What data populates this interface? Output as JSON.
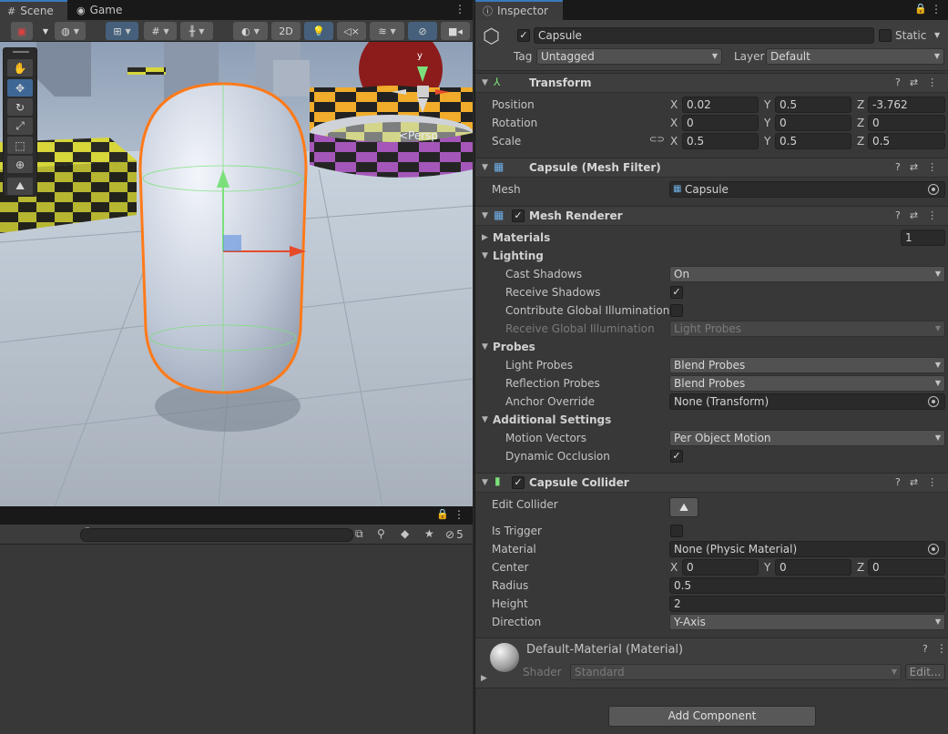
{
  "left_panel": {
    "tabs": [
      {
        "label": "Scene",
        "icon": "grid-icon"
      },
      {
        "label": "Game",
        "icon": "gamepad-icon"
      }
    ],
    "toolbar": {
      "mode_2d": "2D"
    },
    "viewport": {
      "persp_label": "<Persp",
      "gizmo_y_label": "y"
    },
    "lower_panel": {
      "search_placeholder": "",
      "visible_count": "5"
    }
  },
  "inspector": {
    "tab_label": "Inspector",
    "object": {
      "active": true,
      "name": "Capsule",
      "static_label": "Static",
      "tag_label": "Tag",
      "tag_value": "Untagged",
      "layer_label": "Layer",
      "layer_value": "Default"
    },
    "transform": {
      "title": "Transform",
      "position_label": "Position",
      "rotation_label": "Rotation",
      "scale_label": "Scale",
      "x": "X",
      "y": "Y",
      "z": "Z",
      "position": {
        "x": "0.02",
        "y": "0.5",
        "z": "-3.762"
      },
      "rotation": {
        "x": "0",
        "y": "0",
        "z": "0"
      },
      "scale": {
        "x": "0.5",
        "y": "0.5",
        "z": "0.5"
      }
    },
    "mesh_filter": {
      "title": "Capsule (Mesh Filter)",
      "mesh_label": "Mesh",
      "mesh_value": "Capsule"
    },
    "mesh_renderer": {
      "title": "Mesh Renderer",
      "materials_label": "Materials",
      "materials_count": "1",
      "lighting_label": "Lighting",
      "cast_shadows_label": "Cast Shadows",
      "cast_shadows_value": "On",
      "receive_shadows_label": "Receive Shadows",
      "contribute_gi_label": "Contribute Global Illumination",
      "receive_gi_label": "Receive Global Illumination",
      "receive_gi_value": "Light Probes",
      "probes_label": "Probes",
      "light_probes_label": "Light Probes",
      "light_probes_value": "Blend Probes",
      "reflection_probes_label": "Reflection Probes",
      "reflection_probes_value": "Blend Probes",
      "anchor_override_label": "Anchor Override",
      "anchor_override_value": "None (Transform)",
      "additional_settings_label": "Additional Settings",
      "motion_vectors_label": "Motion Vectors",
      "motion_vectors_value": "Per Object Motion",
      "dynamic_occlusion_label": "Dynamic Occlusion"
    },
    "capsule_collider": {
      "title": "Capsule Collider",
      "edit_collider_label": "Edit Collider",
      "is_trigger_label": "Is Trigger",
      "material_label": "Material",
      "material_value": "None (Physic Material)",
      "center_label": "Center",
      "center": {
        "x": "0",
        "y": "0",
        "z": "0"
      },
      "radius_label": "Radius",
      "radius_value": "0.5",
      "height_label": "Height",
      "height_value": "2",
      "direction_label": "Direction",
      "direction_value": "Y-Axis"
    },
    "material": {
      "name": "Default-Material (Material)",
      "shader_label": "Shader",
      "shader_value": "Standard",
      "edit_label": "Edit..."
    },
    "add_component_label": "Add Component"
  },
  "colors": {
    "accent": "#3a79bb",
    "selection_outline": "#ff7a1a",
    "panel": "#383838"
  }
}
